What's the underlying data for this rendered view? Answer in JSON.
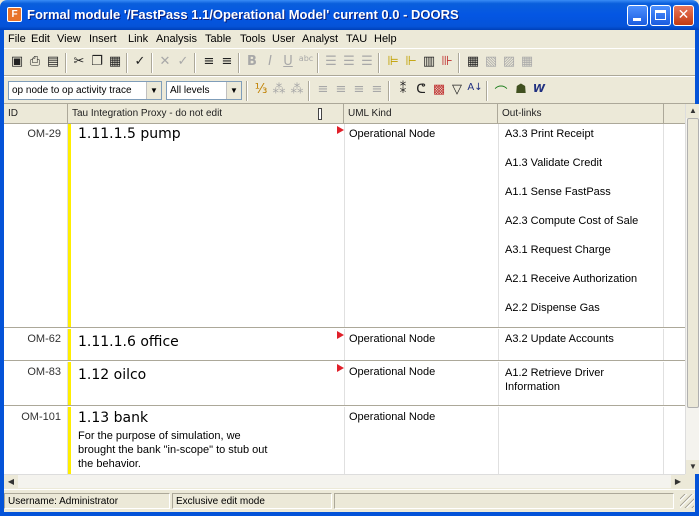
{
  "window": {
    "title": "Formal module '/FastPass 1.1/Operational Model' current 0.0 - DOORS",
    "app_icon_letter": "F"
  },
  "menu": [
    "File",
    "Edit",
    "View",
    "Insert",
    "Link",
    "Analysis",
    "Table",
    "Tools",
    "User",
    "Analyst",
    "TAU",
    "Help"
  ],
  "toolbar": {
    "view_combo": "op node to op activity trace",
    "level_combo": "All levels"
  },
  "columns": {
    "id": "ID",
    "text": "Tau Integration Proxy - do not edit",
    "kind": "UML Kind",
    "links": "Out-links"
  },
  "rows": [
    {
      "id": "OM-29",
      "heading": "1.11.1.5 pump",
      "body": "",
      "kind": "Operational Node",
      "links": [
        "A3.3 Print Receipt",
        "A1.3 Validate Credit",
        "A1.1 Sense FastPass",
        "A2.3 Compute Cost of Sale",
        "A3.1 Request Charge",
        "A2.1 Receive Authorization",
        "A2.2 Dispense Gas"
      ]
    },
    {
      "id": "OM-62",
      "heading": "1.11.1.6 office",
      "body": "",
      "kind": "Operational Node",
      "links": [
        "A3.2 Update Accounts"
      ]
    },
    {
      "id": "OM-83",
      "heading": "1.12 oilco",
      "body": "",
      "kind": "Operational Node",
      "links": [
        "A1.2 Retrieve Driver Information"
      ]
    },
    {
      "id": "OM-101",
      "heading": "1.13 bank",
      "body": "For the purpose of simulation, we brought the bank \"in-scope\" to stub out the behavior.",
      "kind": "Operational Node",
      "links": []
    }
  ],
  "status": {
    "user": "Username: Administrator",
    "mode": "Exclusive edit mode",
    "extra": ""
  }
}
